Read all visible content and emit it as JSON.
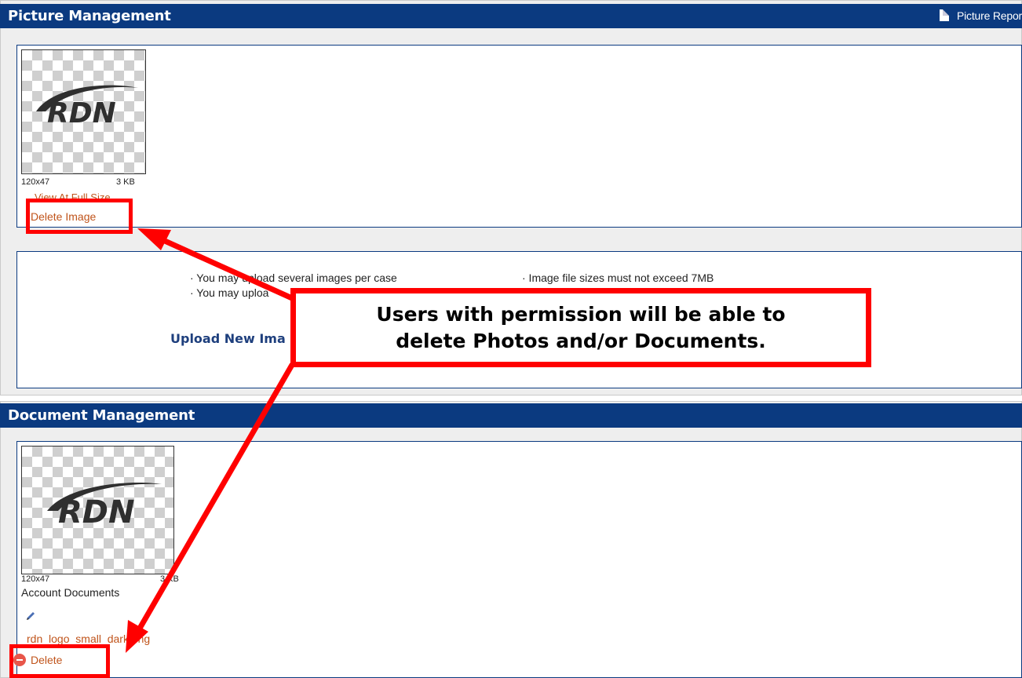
{
  "picture_management": {
    "title": "Picture Management",
    "report_link": "Picture Repor",
    "image": {
      "logo_text": "RDN",
      "dimensions": "120x47",
      "size": "3 KB",
      "view_link": "View At Full Size",
      "delete_link": "Delete Image"
    },
    "info": {
      "left_1": "· You may upload several images per case",
      "right_1": "· Image file sizes must not exceed 7MB",
      "left_2": "· You may uploa"
    },
    "upload_link": "Upload New Ima"
  },
  "callout": {
    "line1": "Users with permission will be able to",
    "line2": "delete Photos and/or Documents."
  },
  "document_management": {
    "title": "Document Management",
    "doc": {
      "logo_text": "RDN",
      "dimensions": "120x47",
      "size": "3 KB",
      "category": "Account Documents",
      "file_name": "rdn_logo_small_dark.png",
      "delete_link": "Delete"
    }
  },
  "colors": {
    "header": "#0b3a80",
    "link": "#c0541b",
    "annotation": "#ff0000"
  }
}
